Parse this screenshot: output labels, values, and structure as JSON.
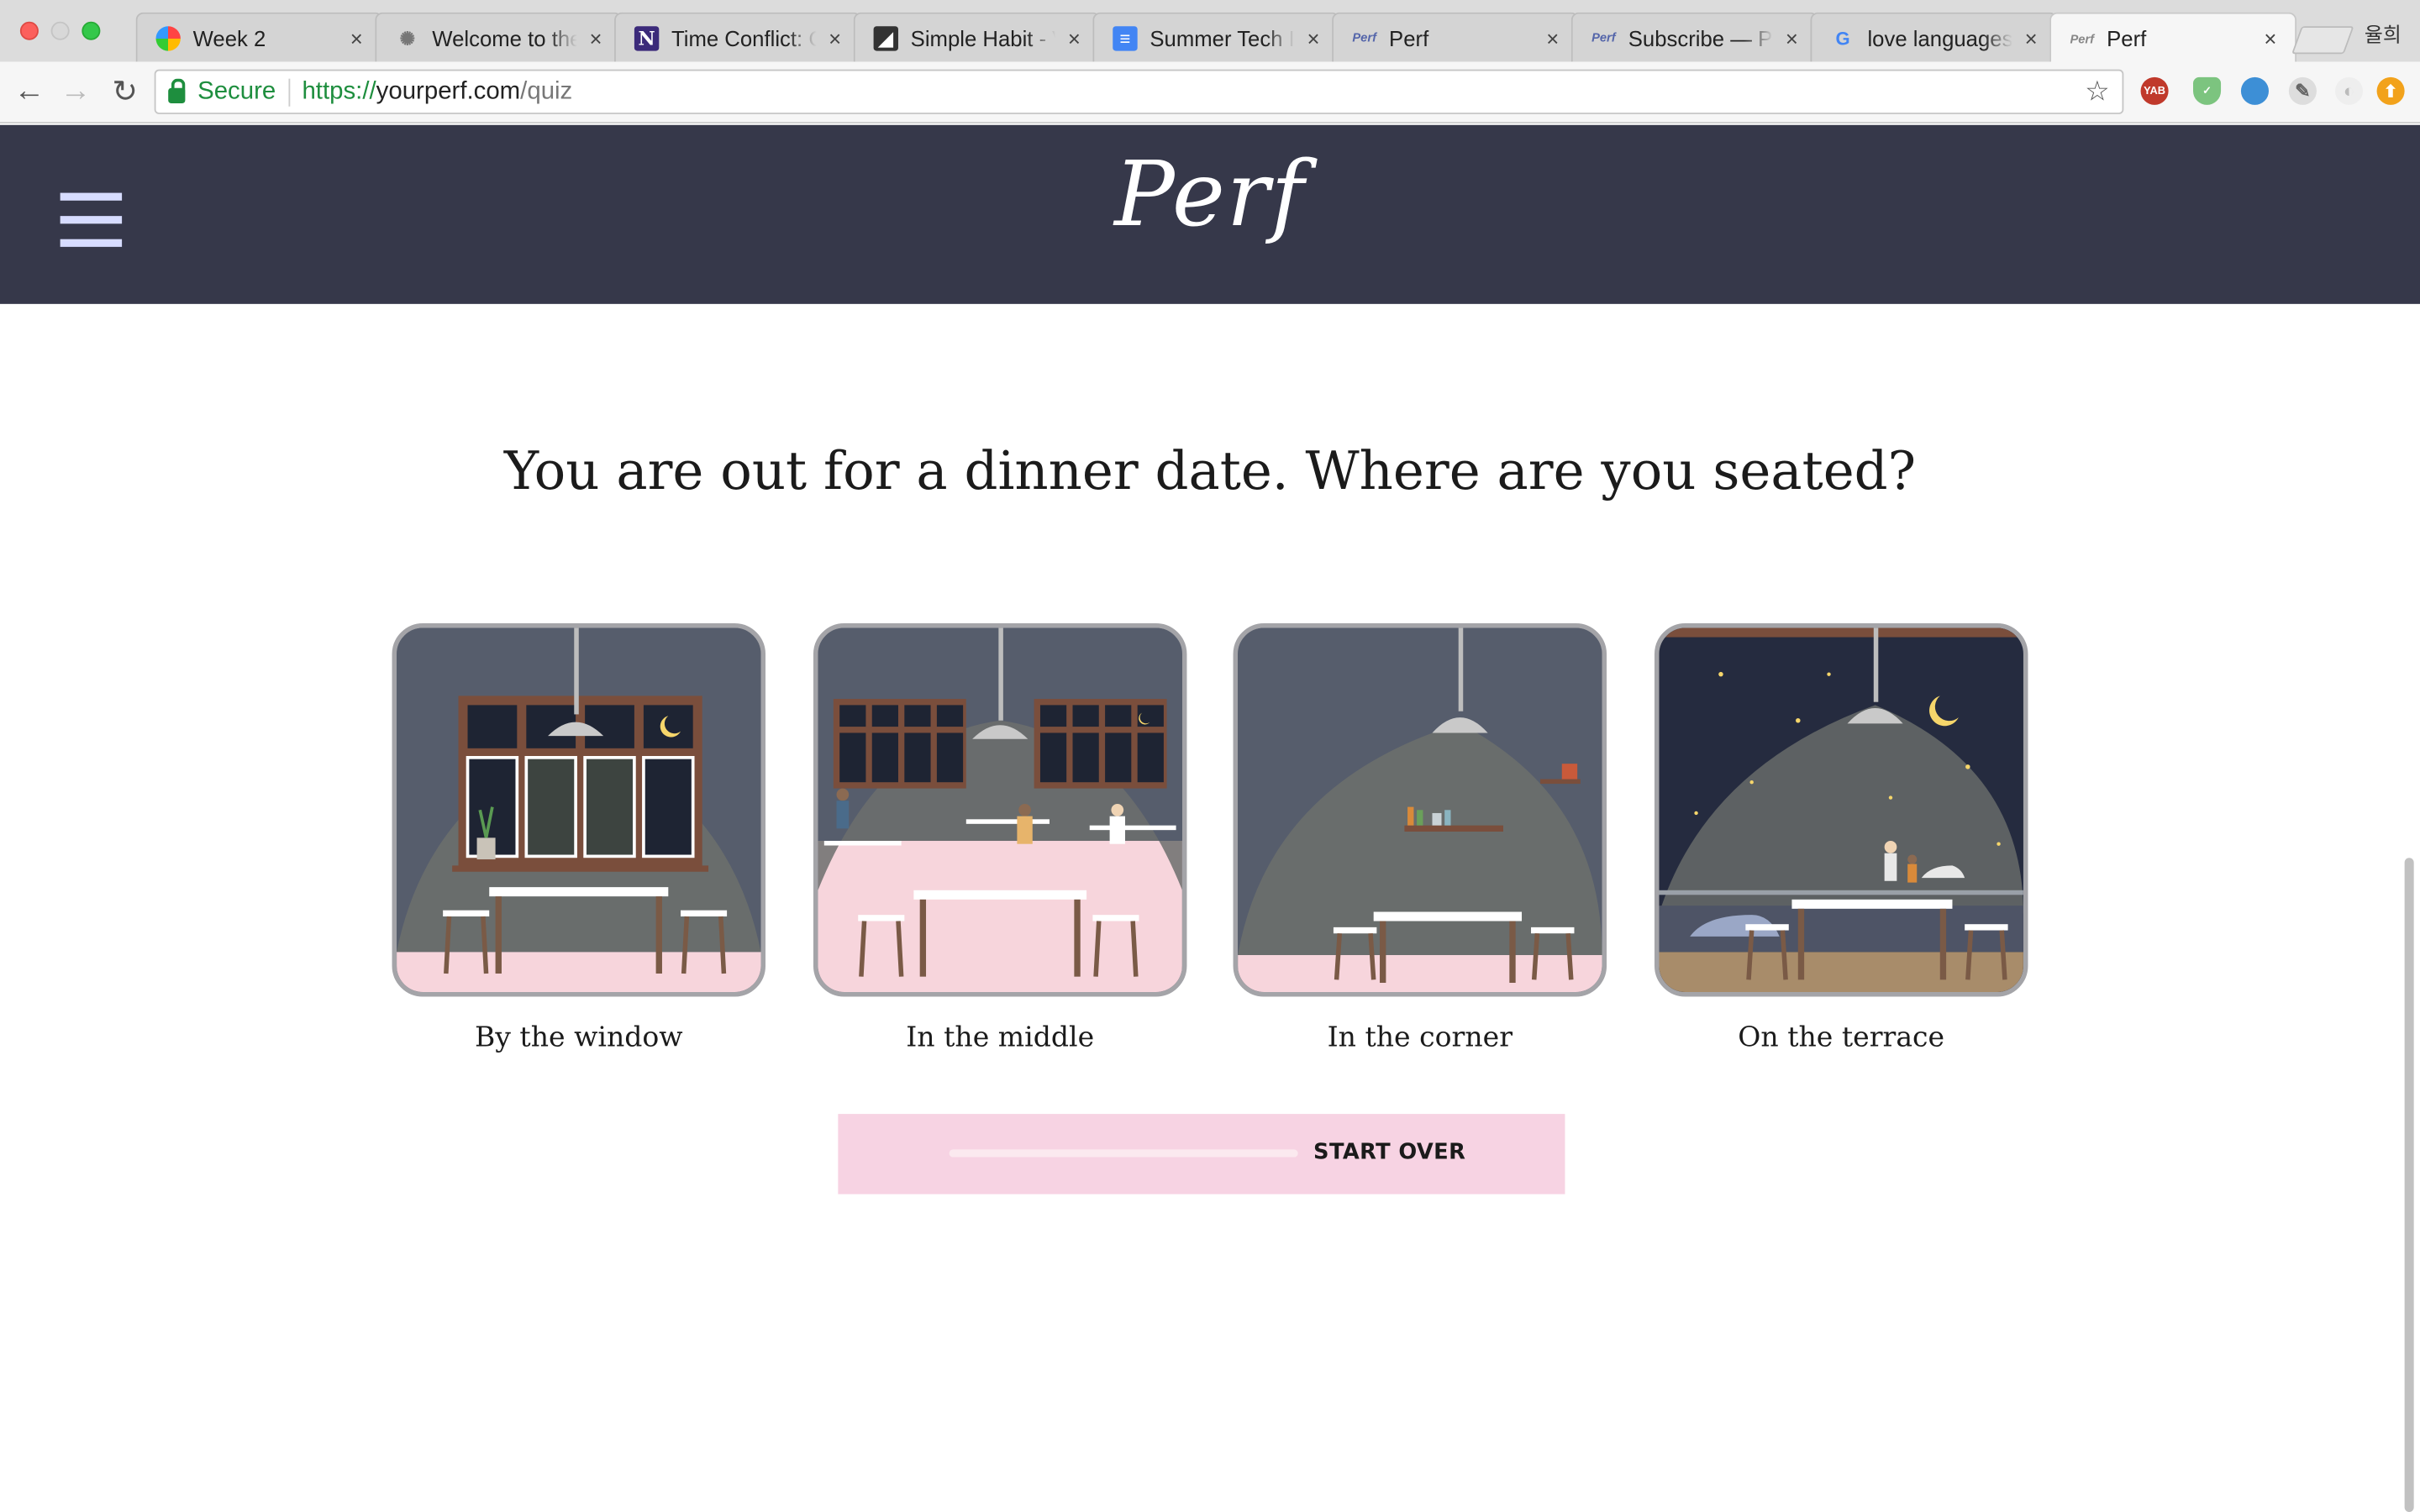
{
  "browser": {
    "tabs": [
      {
        "title": "Week 2",
        "favicon": "colorful-joomla-icon"
      },
      {
        "title": "Welcome to the",
        "favicon": "sunburst-icon"
      },
      {
        "title": "Time Conflict: C",
        "favicon": "n-letter-icon"
      },
      {
        "title": "Simple Habit - V",
        "favicon": "simple-habit-icon"
      },
      {
        "title": "Summer Tech In",
        "favicon": "google-docs-icon"
      },
      {
        "title": "Perf",
        "favicon": "perf-icon"
      },
      {
        "title": "Subscribe — Pe",
        "favicon": "perf-icon"
      },
      {
        "title": "love languages",
        "favicon": "google-icon"
      },
      {
        "title": "Perf",
        "favicon": "perf-icon",
        "active": true
      }
    ],
    "close_glyph": "×",
    "profile_name": "율희",
    "address": {
      "secure_label": "Secure",
      "scheme": "https://",
      "host": "yourperf.com",
      "path": "/quiz"
    },
    "extensions": [
      "YAB",
      "shield",
      "globe",
      "dropper",
      "ghost",
      "bell"
    ]
  },
  "site": {
    "logo": "Perf",
    "menu_icon": "hamburger-menu-icon"
  },
  "quiz": {
    "question": "You are out for a dinner date. Where are you seated?",
    "options": [
      {
        "label": "By the window",
        "scene": "window"
      },
      {
        "label": "In the middle",
        "scene": "middle"
      },
      {
        "label": "In the corner",
        "scene": "corner"
      },
      {
        "label": "On the terrace",
        "scene": "terrace"
      }
    ],
    "start_over_label": "START OVER",
    "progress_track_color": "#fbe9ef",
    "button_color": "#f7d3e3"
  },
  "colors": {
    "header_bg": "#36384a",
    "hamburger": "#d7dcff",
    "floor_pink": "#f7d5dc",
    "wall": "#565d6c",
    "night_sky": "#252b3f",
    "table_wood": "#7a5a46"
  }
}
